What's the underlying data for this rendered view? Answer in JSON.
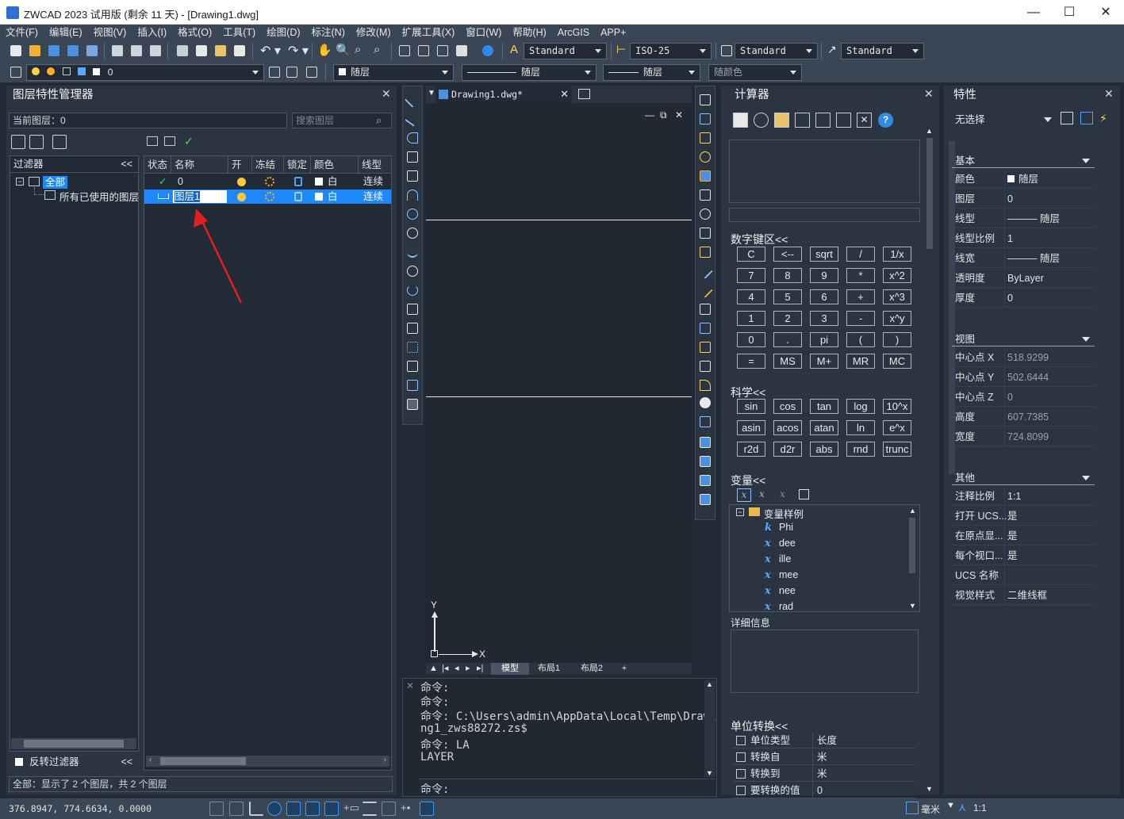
{
  "window": {
    "title": "ZWCAD 2023 试用版 (剩余 11 天) - [Drawing1.dwg]",
    "min": "—",
    "max": "☐",
    "close": "✕"
  },
  "menu": [
    "文件(F)",
    "编辑(E)",
    "视图(V)",
    "插入(I)",
    "格式(O)",
    "工具(T)",
    "绘图(D)",
    "标注(N)",
    "修改(M)",
    "扩展工具(X)",
    "窗口(W)",
    "帮助(H)",
    "ArcGIS",
    "APP+"
  ],
  "toolbar": {
    "text_style": "Standard",
    "dim_style": "ISO-25",
    "table_style": "Standard",
    "mleader_style": "Standard"
  },
  "layerbar": {
    "current_layer": "0",
    "color": "随层",
    "linetype": "随层",
    "lineweight": "随层",
    "plotstyle": "随颜色"
  },
  "layer_manager": {
    "title": "图层特性管理器",
    "current_layer_label": "当前图层：0",
    "search_placeholder": "搜索图层",
    "filters_header": "过滤器",
    "filter_all": "全部",
    "filter_used": "所有已使用的图层",
    "invert_filter": "反转过滤器",
    "status_text": "全部：显示了 2 个图层，共 2 个图层",
    "columns": [
      "状态",
      "名称",
      "开",
      "冻结",
      "锁定",
      "颜色",
      "线型"
    ],
    "rows": [
      {
        "status": "✓",
        "name": "0",
        "color": "白",
        "linetype": "连续",
        "selected": false
      },
      {
        "status": "",
        "name": "图层1",
        "color": "白",
        "linetype": "连续",
        "selected": true
      }
    ]
  },
  "drawing": {
    "tab": "Drawing1.dwg*",
    "layout_tabs": [
      "模型",
      "布局1",
      "布局2",
      "+"
    ],
    "axis_y": "Y",
    "axis_x": "X"
  },
  "command": {
    "lines": [
      "命令:",
      "命令:",
      "命令: C:\\Users\\admin\\AppData\\Local\\Temp\\Drawi",
      "ng1_zws88272.zs$",
      "命令: LA",
      "LAYER"
    ],
    "prompt": "命令:"
  },
  "calculator": {
    "title": "计算器",
    "numpad_label": "数字键区<<",
    "numpad": [
      [
        "C",
        "<--",
        "sqrt",
        "/",
        "1/x"
      ],
      [
        "7",
        "8",
        "9",
        "*",
        "x^2"
      ],
      [
        "4",
        "5",
        "6",
        "+",
        "x^3"
      ],
      [
        "1",
        "2",
        "3",
        "-",
        "x^y"
      ],
      [
        "0",
        ".",
        "pi",
        "(",
        ")"
      ],
      [
        "=",
        "MS",
        "M+",
        "MR",
        "MC"
      ]
    ],
    "sci_label": "科学<<",
    "sci": [
      [
        "sin",
        "cos",
        "tan",
        "log",
        "10^x"
      ],
      [
        "asin",
        "acos",
        "atan",
        "ln",
        "e^x"
      ],
      [
        "r2d",
        "d2r",
        "abs",
        "rnd",
        "trunc"
      ]
    ],
    "var_label": "变量<<",
    "var_root": "变量样例",
    "vars": [
      {
        "t": "k",
        "n": "Phi"
      },
      {
        "t": "x",
        "n": "dee"
      },
      {
        "t": "x",
        "n": "ille"
      },
      {
        "t": "x",
        "n": "mee"
      },
      {
        "t": "x",
        "n": "nee"
      },
      {
        "t": "x",
        "n": "rad"
      }
    ],
    "details_label": "详细信息",
    "unit_label": "单位转换<<",
    "units": [
      {
        "k": "单位类型",
        "v": "长度"
      },
      {
        "k": "转换自",
        "v": "米"
      },
      {
        "k": "转换到",
        "v": "米"
      },
      {
        "k": "要转换的值",
        "v": "0"
      }
    ]
  },
  "properties": {
    "title": "特性",
    "selection": "无选择",
    "basic_label": "基本",
    "basic": [
      {
        "k": "颜色",
        "v": "随层"
      },
      {
        "k": "图层",
        "v": "0"
      },
      {
        "k": "线型",
        "v": "——— 随层"
      },
      {
        "k": "线型比例",
        "v": "1"
      },
      {
        "k": "线宽",
        "v": "——— 随层"
      },
      {
        "k": "透明度",
        "v": "ByLayer"
      },
      {
        "k": "厚度",
        "v": "0"
      }
    ],
    "view_label": "视图",
    "view": [
      {
        "k": "中心点 X",
        "v": "518.9299"
      },
      {
        "k": "中心点 Y",
        "v": "502.6444"
      },
      {
        "k": "中心点 Z",
        "v": "0"
      },
      {
        "k": "高度",
        "v": "607.7385"
      },
      {
        "k": "宽度",
        "v": "724.8099"
      }
    ],
    "other_label": "其他",
    "other": [
      {
        "k": "注释比例",
        "v": "1:1"
      },
      {
        "k": "打开 UCS...",
        "v": "是"
      },
      {
        "k": "在原点显...",
        "v": "是"
      },
      {
        "k": "每个视口...",
        "v": "是"
      },
      {
        "k": "UCS 名称",
        "v": ""
      },
      {
        "k": "视觉样式",
        "v": "二维线框"
      }
    ]
  },
  "statusbar": {
    "coords": "376.8947,  774.6634,  0.0000",
    "units": "毫米",
    "scale": "1:1"
  },
  "colors": {
    "accent": "#1e88ff",
    "selection": "#1e88ff",
    "arrow": "#e02020"
  }
}
